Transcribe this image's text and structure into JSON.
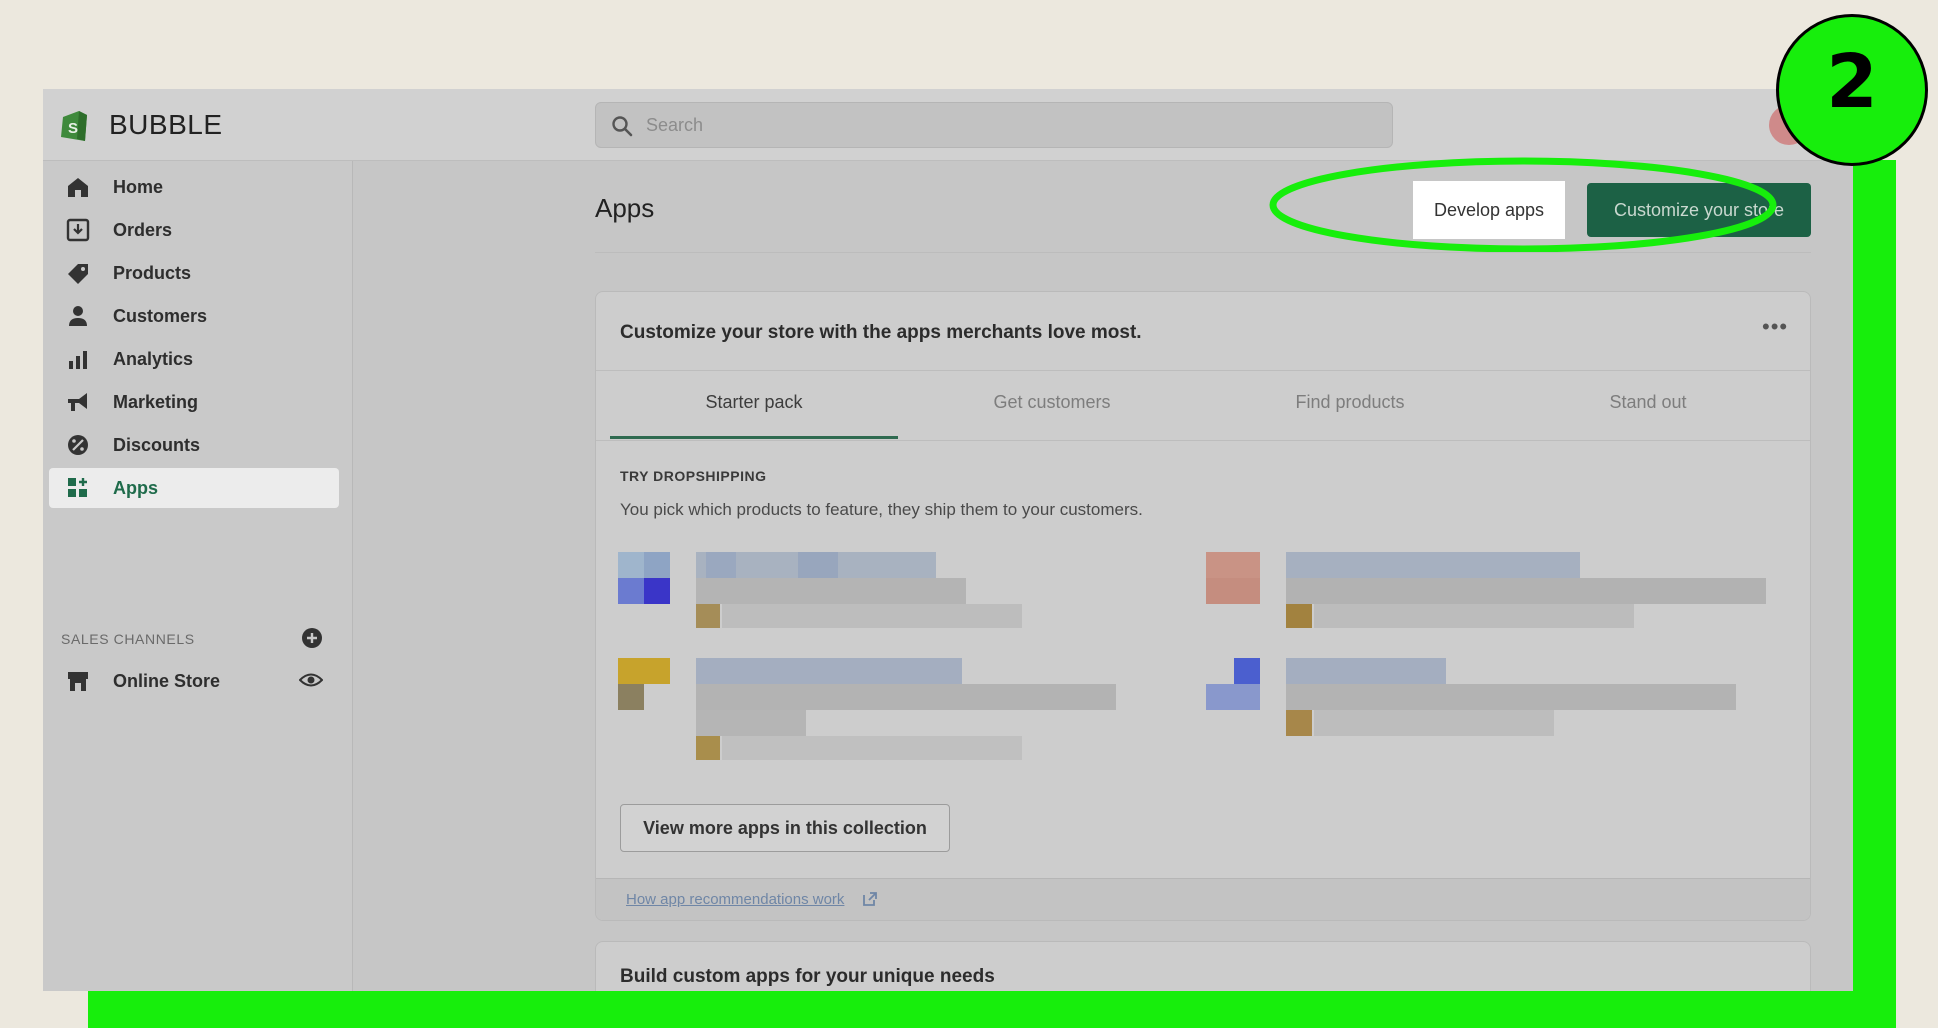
{
  "header": {
    "store_name": "BUBBLE",
    "search_placeholder": "Search"
  },
  "sidebar": {
    "items": [
      {
        "label": "Home",
        "icon": "home-icon"
      },
      {
        "label": "Orders",
        "icon": "orders-icon"
      },
      {
        "label": "Products",
        "icon": "tag-icon"
      },
      {
        "label": "Customers",
        "icon": "person-icon"
      },
      {
        "label": "Analytics",
        "icon": "bar-chart-icon"
      },
      {
        "label": "Marketing",
        "icon": "megaphone-icon"
      },
      {
        "label": "Discounts",
        "icon": "discount-icon"
      },
      {
        "label": "Apps",
        "icon": "apps-grid-icon"
      }
    ],
    "active_item": "Apps",
    "channels_title": "SALES CHANNELS",
    "channels": [
      {
        "label": "Online Store",
        "icon": "store-icon"
      }
    ]
  },
  "main": {
    "title": "Apps",
    "develop_label": "Develop apps",
    "customize_label": "Customize your store",
    "card": {
      "heading": "Customize your store with the apps merchants love most.",
      "tabs": [
        {
          "label": "Starter pack"
        },
        {
          "label": "Get customers"
        },
        {
          "label": "Find products"
        },
        {
          "label": "Stand out"
        }
      ],
      "active_tab": "Starter pack",
      "collection_title": "TRY DROPSHIPPING",
      "collection_description": "You pick which products to feature, they ship them to your customers.",
      "view_more_label": "View more apps in this collection",
      "footer_link": "How app recommendations work"
    },
    "card2_heading": "Build custom apps for your unique needs"
  },
  "step_badge": "2",
  "colors": {
    "frame_green": "#17ee0c",
    "primary_button": "#1c6145",
    "active_nav": "#1f6b4b"
  }
}
